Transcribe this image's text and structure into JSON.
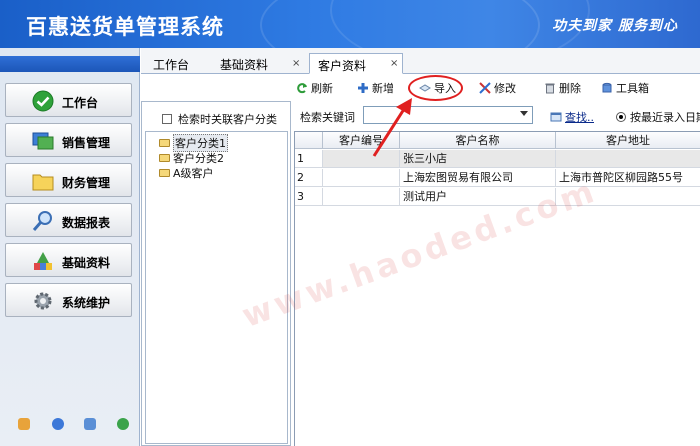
{
  "app": {
    "title": "百惠送货单管理系统",
    "slogan": "功夫到家 服务到心"
  },
  "sidebar": {
    "items": [
      {
        "label": "工作台",
        "icon": "check-circle-icon"
      },
      {
        "label": "销售管理",
        "icon": "window-stack-icon"
      },
      {
        "label": "财务管理",
        "icon": "folder-icon"
      },
      {
        "label": "数据报表",
        "icon": "magnifier-icon"
      },
      {
        "label": "基础资料",
        "icon": "building-blocks-icon"
      },
      {
        "label": "系统维护",
        "icon": "gear-icon"
      }
    ],
    "footer_icons": [
      "key-icon",
      "clock-icon",
      "search-window-icon",
      "exit-icon"
    ]
  },
  "tabs": [
    {
      "label": "工作台",
      "closable": false
    },
    {
      "label": "基础资料",
      "closable": true
    },
    {
      "label": "客户资料",
      "closable": true,
      "active": true
    }
  ],
  "toolbar": {
    "buttons": [
      {
        "label": "刷新",
        "icon": "refresh-icon"
      },
      {
        "label": "新增",
        "icon": "plus-icon"
      },
      {
        "label": "导入",
        "icon": "import-icon"
      },
      {
        "label": "修改",
        "icon": "edit-icon"
      },
      {
        "label": "删除",
        "icon": "trash-icon"
      },
      {
        "label": "工具箱",
        "icon": "toolbox-icon"
      }
    ]
  },
  "left_panel": {
    "checkbox_label": "检索时关联客户分类",
    "tree": [
      {
        "label": "客户分类1",
        "selected": true
      },
      {
        "label": "客户分类2",
        "selected": false
      },
      {
        "label": "A级客户",
        "selected": false
      }
    ]
  },
  "search": {
    "label": "检索关键词",
    "value": "",
    "find_label": "查找..",
    "radio_label": "按最近录入日期"
  },
  "grid": {
    "columns": [
      "客户编号",
      "客户名称",
      "客户地址"
    ],
    "rows": [
      {
        "n": "1",
        "code": "",
        "name": "张三小店",
        "address": ""
      },
      {
        "n": "2",
        "code": "",
        "name": "上海宏图贸易有限公司",
        "address": "上海市普陀区柳园路55号"
      },
      {
        "n": "3",
        "code": "",
        "name": "测试用户",
        "address": ""
      }
    ]
  },
  "watermark": "www.haoded.com",
  "colors": {
    "title_blue": "#2f7be3",
    "highlight_red": "#e02020",
    "folder_yellow": "#f5d87a"
  }
}
